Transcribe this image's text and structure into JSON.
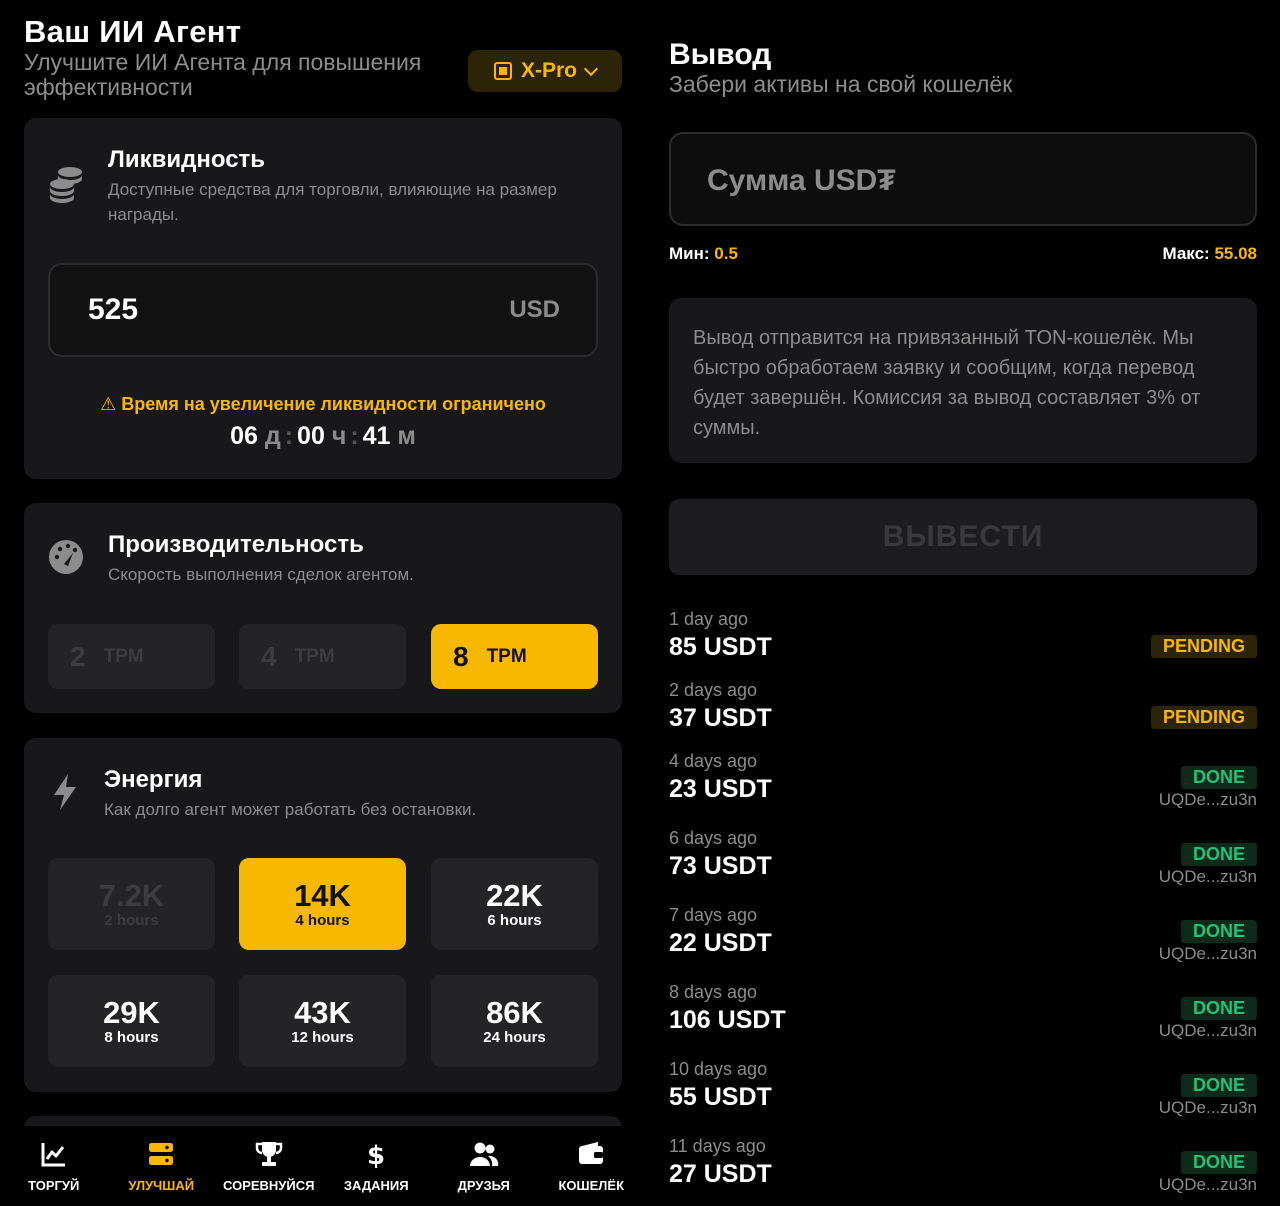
{
  "header": {
    "title": "Ваш ИИ Агент",
    "subtitle": "Улучшите ИИ Агента для повышения эффективности",
    "tier": "X-Pro"
  },
  "liquidity": {
    "title": "Ликвидность",
    "description": "Доступные средства для торговли, влияющие на размер награды.",
    "value": "525",
    "currency": "USD",
    "warning": "⚠ Время на увеличение ликвидности ограничено",
    "timer": {
      "days": "06",
      "days_unit": "д",
      "hours": "00",
      "hours_unit": "ч",
      "minutes": "41",
      "minutes_unit": "м"
    }
  },
  "performance": {
    "title": "Производительность",
    "description": "Скорость выполнения сделок агентом.",
    "options": [
      {
        "value": "2",
        "unit": "TPM"
      },
      {
        "value": "4",
        "unit": "TPM"
      },
      {
        "value": "8",
        "unit": "TPM"
      }
    ]
  },
  "energy": {
    "title": "Энергия",
    "description": "Как долго агент может работать без остановки.",
    "options": [
      {
        "value": "7.2K",
        "duration": "2 hours"
      },
      {
        "value": "14K",
        "duration": "4 hours"
      },
      {
        "value": "22K",
        "duration": "6 hours"
      },
      {
        "value": "29K",
        "duration": "8 hours"
      },
      {
        "value": "43K",
        "duration": "12 hours"
      },
      {
        "value": "86K",
        "duration": "24 hours"
      }
    ]
  },
  "nav": [
    {
      "label": "ТОРГУЙ",
      "icon": "chart-icon"
    },
    {
      "label": "УЛУЧШАЙ",
      "icon": "server-icon"
    },
    {
      "label": "СОРЕВНУЙСЯ",
      "icon": "trophy-icon"
    },
    {
      "label": "ЗАДАНИЯ",
      "icon": "dollar-icon"
    },
    {
      "label": "ДРУЗЬЯ",
      "icon": "users-icon"
    },
    {
      "label": "КОШЕЛЁК",
      "icon": "wallet-icon"
    }
  ],
  "withdraw": {
    "title": "Вывод",
    "subtitle": "Забери активы на свой кошелёк",
    "placeholder": "Сумма USD₮",
    "min_label": "Мин:",
    "min": "0.5",
    "max_label": "Макс:",
    "max": "55.08",
    "info": "Вывод отправится на привязанный TON-кошелёк. Мы быстро обработаем заявку и сообщим, когда перевод будет завершён. Комиссия за вывод составляет 3% от суммы.",
    "button": "ВЫВЕСТИ"
  },
  "history": [
    {
      "when": "1 day ago",
      "amount": "85 USDT",
      "status": "PENDING",
      "address": ""
    },
    {
      "when": "2 days ago",
      "amount": "37 USDT",
      "status": "PENDING",
      "address": ""
    },
    {
      "when": "4 days ago",
      "amount": "23 USDT",
      "status": "DONE",
      "address": "UQDe...zu3n"
    },
    {
      "when": "6 days ago",
      "amount": "73 USDT",
      "status": "DONE",
      "address": "UQDe...zu3n"
    },
    {
      "when": "7 days ago",
      "amount": "22 USDT",
      "status": "DONE",
      "address": "UQDe...zu3n"
    },
    {
      "when": "8 days ago",
      "amount": "106 USDT",
      "status": "DONE",
      "address": "UQDe...zu3n"
    },
    {
      "when": "10 days ago",
      "amount": "55 USDT",
      "status": "DONE",
      "address": "UQDe...zu3n"
    },
    {
      "when": "11 days ago",
      "amount": "27 USDT",
      "status": "DONE",
      "address": "UQDe...zu3n"
    }
  ]
}
